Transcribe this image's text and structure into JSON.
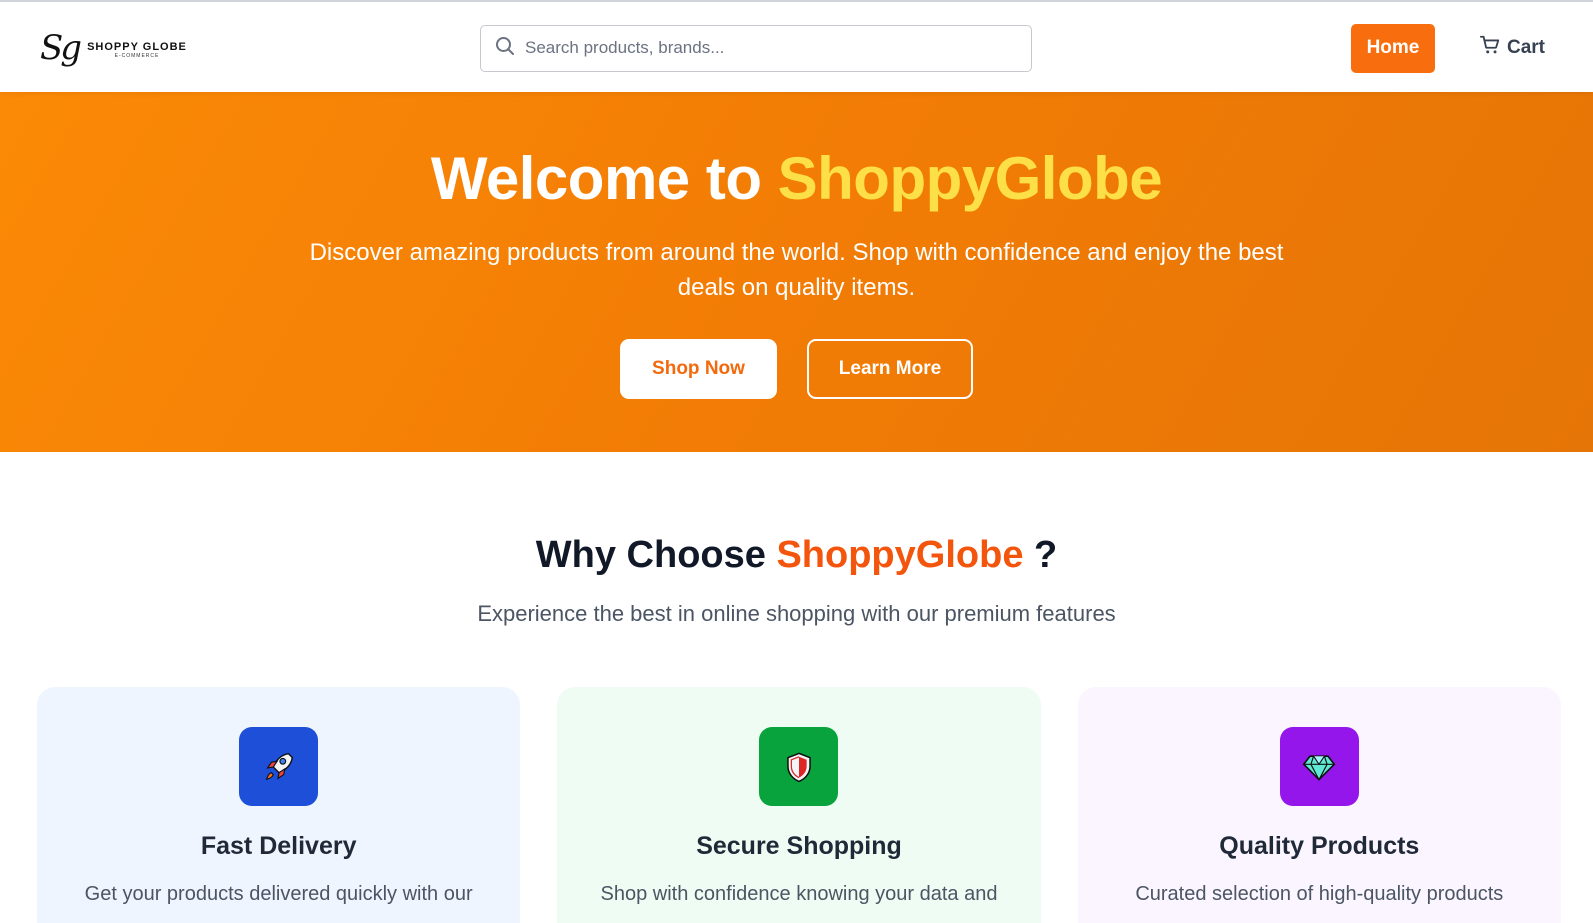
{
  "brand": {
    "logo_mark": "Sg",
    "logo_name": "SHOPPY GLOBE",
    "logo_sub": "E-COMMERCE",
    "accent": "#f86e0e"
  },
  "search": {
    "placeholder": "Search products, brands..."
  },
  "nav": {
    "home_label": "Home",
    "cart_label": "Cart"
  },
  "hero": {
    "title_prefix": "Welcome to ",
    "title_brand": "ShoppyGlobe",
    "subtitle": "Discover amazing products from around the world. Shop with confidence and enjoy the best deals on quality items.",
    "shop_now_label": "Shop Now",
    "learn_more_label": "Learn More"
  },
  "why": {
    "title_prefix": "Why Choose ",
    "title_brand": "ShoppyGlobe",
    "title_suffix": " ?",
    "subtitle": "Experience the best in online shopping with our premium features"
  },
  "features": [
    {
      "icon": "rocket-icon",
      "title": "Fast Delivery",
      "description": "Get your products delivered quickly with our",
      "color": "#1d4fd8"
    },
    {
      "icon": "shield-icon",
      "title": "Secure Shopping",
      "description": "Shop with confidence knowing your data and",
      "color": "#08a33c"
    },
    {
      "icon": "diamond-icon",
      "title": "Quality Products",
      "description": "Curated selection of high-quality products",
      "color": "#9516eb"
    }
  ]
}
